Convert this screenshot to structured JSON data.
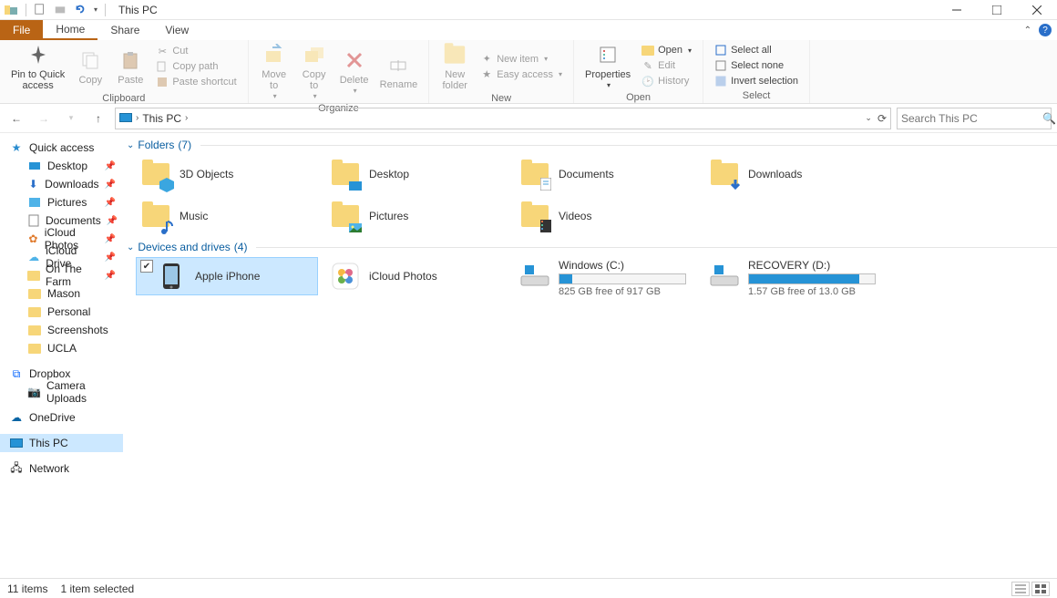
{
  "window": {
    "title": "This PC"
  },
  "tabs": {
    "file": "File",
    "home": "Home",
    "share": "Share",
    "view": "View"
  },
  "ribbon": {
    "clipboard": {
      "label": "Clipboard",
      "pin": "Pin to Quick\naccess",
      "copy": "Copy",
      "paste": "Paste",
      "cut": "Cut",
      "copy_path": "Copy path",
      "paste_shortcut": "Paste shortcut"
    },
    "organize": {
      "label": "Organize",
      "move_to": "Move\nto",
      "copy_to": "Copy\nto",
      "delete": "Delete",
      "rename": "Rename"
    },
    "new": {
      "label": "New",
      "new_folder": "New\nfolder",
      "new_item": "New item",
      "easy_access": "Easy access"
    },
    "open": {
      "label": "Open",
      "properties": "Properties",
      "open": "Open",
      "edit": "Edit",
      "history": "History"
    },
    "select": {
      "label": "Select",
      "select_all": "Select all",
      "select_none": "Select none",
      "invert": "Invert selection"
    }
  },
  "address": {
    "location": "This PC",
    "search_placeholder": "Search This PC"
  },
  "navpane": {
    "quick_access": "Quick access",
    "items": [
      {
        "label": "Desktop",
        "pin": true,
        "icon": "desktop"
      },
      {
        "label": "Downloads",
        "pin": true,
        "icon": "downloads"
      },
      {
        "label": "Pictures",
        "pin": true,
        "icon": "pictures"
      },
      {
        "label": "Documents",
        "pin": true,
        "icon": "documents"
      },
      {
        "label": "iCloud Photos",
        "pin": true,
        "icon": "icloud-photos"
      },
      {
        "label": "iCloud Drive",
        "pin": true,
        "icon": "icloud-drive"
      },
      {
        "label": "On The Farm",
        "pin": true,
        "icon": "folder"
      },
      {
        "label": "Mason",
        "pin": false,
        "icon": "folder"
      },
      {
        "label": "Personal",
        "pin": false,
        "icon": "folder"
      },
      {
        "label": "Screenshots",
        "pin": false,
        "icon": "folder"
      },
      {
        "label": "UCLA",
        "pin": false,
        "icon": "folder"
      }
    ],
    "dropbox": "Dropbox",
    "camera_uploads": "Camera Uploads",
    "onedrive": "OneDrive",
    "this_pc": "This PC",
    "network": "Network"
  },
  "groups": {
    "folders": {
      "title": "Folders",
      "count": "(7)"
    },
    "devices": {
      "title": "Devices and drives",
      "count": "(4)"
    }
  },
  "folders": [
    {
      "label": "3D Objects"
    },
    {
      "label": "Desktop"
    },
    {
      "label": "Documents"
    },
    {
      "label": "Downloads"
    },
    {
      "label": "Music"
    },
    {
      "label": "Pictures"
    },
    {
      "label": "Videos"
    }
  ],
  "devices": [
    {
      "label": "Apple iPhone",
      "type": "phone",
      "selected": true
    },
    {
      "label": "iCloud Photos",
      "type": "app"
    },
    {
      "label": "Windows (C:)",
      "type": "drive",
      "free": "825 GB free of 917 GB",
      "fill_pct": 10
    },
    {
      "label": "RECOVERY (D:)",
      "type": "drive",
      "free": "1.57 GB free of 13.0 GB",
      "fill_pct": 88
    }
  ],
  "status": {
    "items": "11 items",
    "selected": "1 item selected"
  }
}
